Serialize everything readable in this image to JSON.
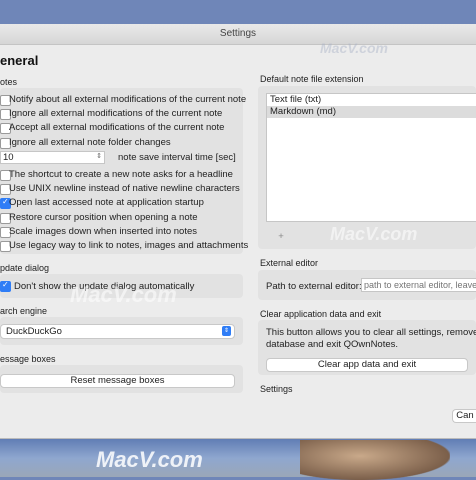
{
  "window": {
    "title": "Settings"
  },
  "general": {
    "heading": "eneral",
    "notes_label": "otes",
    "checks": [
      {
        "label": "Notify about all external modifications of the current note",
        "checked": false
      },
      {
        "label": "Ignore all external modifications of the current note",
        "checked": false
      },
      {
        "label": "Accept all external modifications of the current note",
        "checked": false
      },
      {
        "label": "Ignore all external note folder changes",
        "checked": false
      }
    ],
    "interval_value": "10",
    "interval_label": "note save interval time [sec]",
    "checks2": [
      {
        "label": "The shortcut to create a new note asks for a headline",
        "checked": false
      },
      {
        "label": "Use UNIX newline instead of native newline characters",
        "checked": false
      },
      {
        "label": "Open last accessed note at application startup",
        "checked": true
      },
      {
        "label": "Restore cursor position when opening a note",
        "checked": false
      },
      {
        "label": "Scale images down when inserted into notes",
        "checked": false
      },
      {
        "label": "Use legacy way to link to notes, images and attachments",
        "checked": false
      }
    ],
    "update_label": "pdate dialog",
    "update_check": {
      "label": "Don't show the update dialog automatically",
      "checked": true
    },
    "search_label": "arch engine",
    "search_value": "DuckDuckGo",
    "msg_label": "essage boxes",
    "reset_button": "Reset message boxes"
  },
  "right": {
    "ext_label": "Default note file extension",
    "extensions": [
      {
        "label": "Text file (txt)",
        "selected": false
      },
      {
        "label": "Markdown (md)",
        "selected": true
      }
    ],
    "add_button": "+",
    "editor_label": "External editor",
    "editor_field_label": "Path to external editor:",
    "editor_placeholder": "path to external editor, leave",
    "clear_label": "Clear application data and exit",
    "clear_text_1": "This button allows you to clear all settings, remove the",
    "clear_text_2": "database and exit QOwnNotes.",
    "clear_button": "Clear app data and exit",
    "settings_label": "Settings",
    "cancel_button": "Can"
  },
  "watermark": "MacV.com"
}
